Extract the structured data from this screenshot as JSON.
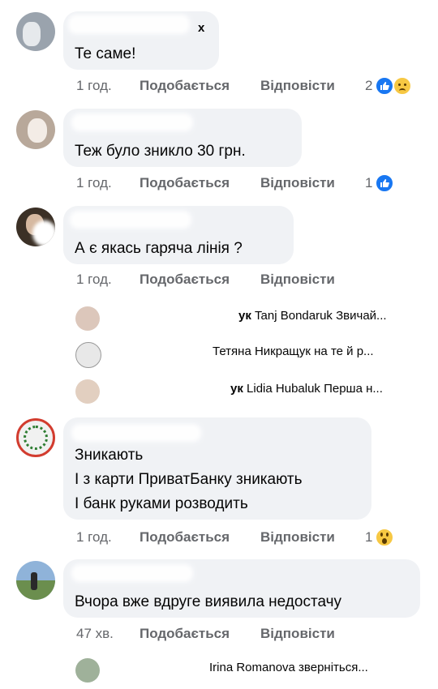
{
  "comments": [
    {
      "author_visible": "x",
      "text": [
        "Те саме!"
      ],
      "time": "1 год.",
      "like": "Подобається",
      "reply": "Відповісти",
      "reaction_count": "2",
      "reactions": [
        "like-icon",
        "sad-icon"
      ]
    },
    {
      "author_visible": "",
      "text": [
        "Теж було зникло 30 грн."
      ],
      "time": "1 год.",
      "like": "Подобається",
      "reply": "Відповісти",
      "reaction_count": "1",
      "reactions": [
        "like-icon"
      ]
    },
    {
      "author_visible": "",
      "text": [
        "А є якась гаряча лінія ?"
      ],
      "time": "1 год.",
      "like": "Подобається",
      "reply": "Відповісти",
      "reaction_count": "",
      "reactions": []
    },
    {
      "author_visible": "",
      "text": [
        "Зникають",
        "І з карти ПриватБанку зникають",
        "І банк руками розводить"
      ],
      "time": "1 год.",
      "like": "Подобається",
      "reply": "Відповісти",
      "reaction_count": "1",
      "reactions": [
        "wow-icon"
      ]
    },
    {
      "author_visible": "",
      "text": [
        "Вчора вже вдруге виявила недостачу"
      ],
      "time": "47 хв.",
      "like": "Подобається",
      "reply": "Відповісти",
      "reaction_count": "",
      "reactions": []
    }
  ],
  "replies_group_1": [
    {
      "author_visible": "ук",
      "text": "Tanj Bondaruk Звичай..."
    },
    {
      "author_visible": "",
      "text": "Тетяна Никращук на те й р..."
    },
    {
      "author_visible": "ук",
      "text": "Lidia Hubaluk Перша н..."
    }
  ],
  "replies_group_2": [
    {
      "author_visible": "",
      "text": "Irina Romanova зверніться..."
    }
  ],
  "colors": {
    "bubble": "#f0f2f5",
    "meta": "#65676b",
    "like": "#1877f2",
    "emoji": "#f7c843"
  }
}
